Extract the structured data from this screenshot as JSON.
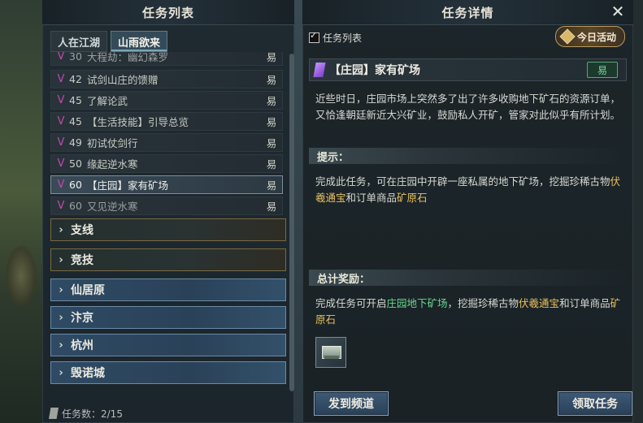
{
  "left_panel": {
    "title": "任务列表",
    "tabs": [
      {
        "label": "人在江湖",
        "active": false
      },
      {
        "label": "山雨欲来",
        "active": true
      }
    ],
    "quests": [
      {
        "level": "30",
        "name": "大程劫：幽幻森罗",
        "difficulty": "易",
        "selected": false
      },
      {
        "level": "42",
        "name": "试剑山庄的馈赠",
        "difficulty": "易",
        "selected": false
      },
      {
        "level": "45",
        "name": "了解论武",
        "difficulty": "易",
        "selected": false
      },
      {
        "level": "45",
        "name": "【生活技能】引导总览",
        "difficulty": "易",
        "selected": false
      },
      {
        "level": "49",
        "name": "初试仗剑行",
        "difficulty": "易",
        "selected": false
      },
      {
        "level": "50",
        "name": "缘起逆水寒",
        "difficulty": "易",
        "selected": false
      },
      {
        "level": "60",
        "name": "【庄园】家有矿场",
        "difficulty": "易",
        "selected": true
      },
      {
        "level": "60",
        "name": "又见逆水寒",
        "difficulty": "易",
        "selected": false
      }
    ],
    "sections": [
      {
        "label": "支线",
        "style": "brown"
      },
      {
        "label": "竞技",
        "style": "brown"
      },
      {
        "label": "仙居原",
        "style": "blue"
      },
      {
        "label": "汴京",
        "style": "blue"
      },
      {
        "label": "杭州",
        "style": "blue"
      },
      {
        "label": "毁诺城",
        "style": "blue"
      }
    ],
    "task_count": "任务数：2/15"
  },
  "right_panel": {
    "title": "任务详情",
    "close_glyph": "✕",
    "checkbox_label": "任务列表",
    "checkbox_checked": true,
    "today_activity": "今日活动",
    "quest_title": "【庄园】家有矿场",
    "quest_difficulty": "易",
    "description": "近些时日，庄园市场上突然多了出了许多收购地下矿石的资源订单，又恰逢朝廷新近大兴矿业，鼓励私人开矿，管家对此似乎有所计划。",
    "hint_header": "提示：",
    "hint": {
      "part1": "完成此任务，可在庄园中开辟一座私属的地下矿场，挖掘珍稀古物",
      "gold1": "伏羲通宝",
      "part2": "和订单商品",
      "gold2": "矿原石"
    },
    "reward_header": "总计奖励：",
    "reward": {
      "part1": "完成任务可开启",
      "green1": "庄园地下矿场",
      "part2": "，挖掘珍稀古物",
      "gold1": "伏羲通宝",
      "part3": "和订单商品",
      "gold2": "矿原石"
    },
    "buttons": {
      "send_to_channel": "发到频道",
      "accept_quest": "领取任务"
    }
  },
  "icons": {
    "quest_marker": "purple-v-icon",
    "section_chevron": "chevron-right-icon",
    "close": "close-icon",
    "today": "diamond-icon",
    "count": "scroll-icon"
  },
  "colors": {
    "quest_marker": "#c24aa8",
    "gold_highlight": "#e8c060",
    "green_highlight": "#6ad88e",
    "difficulty_green": "#78d8a0"
  }
}
